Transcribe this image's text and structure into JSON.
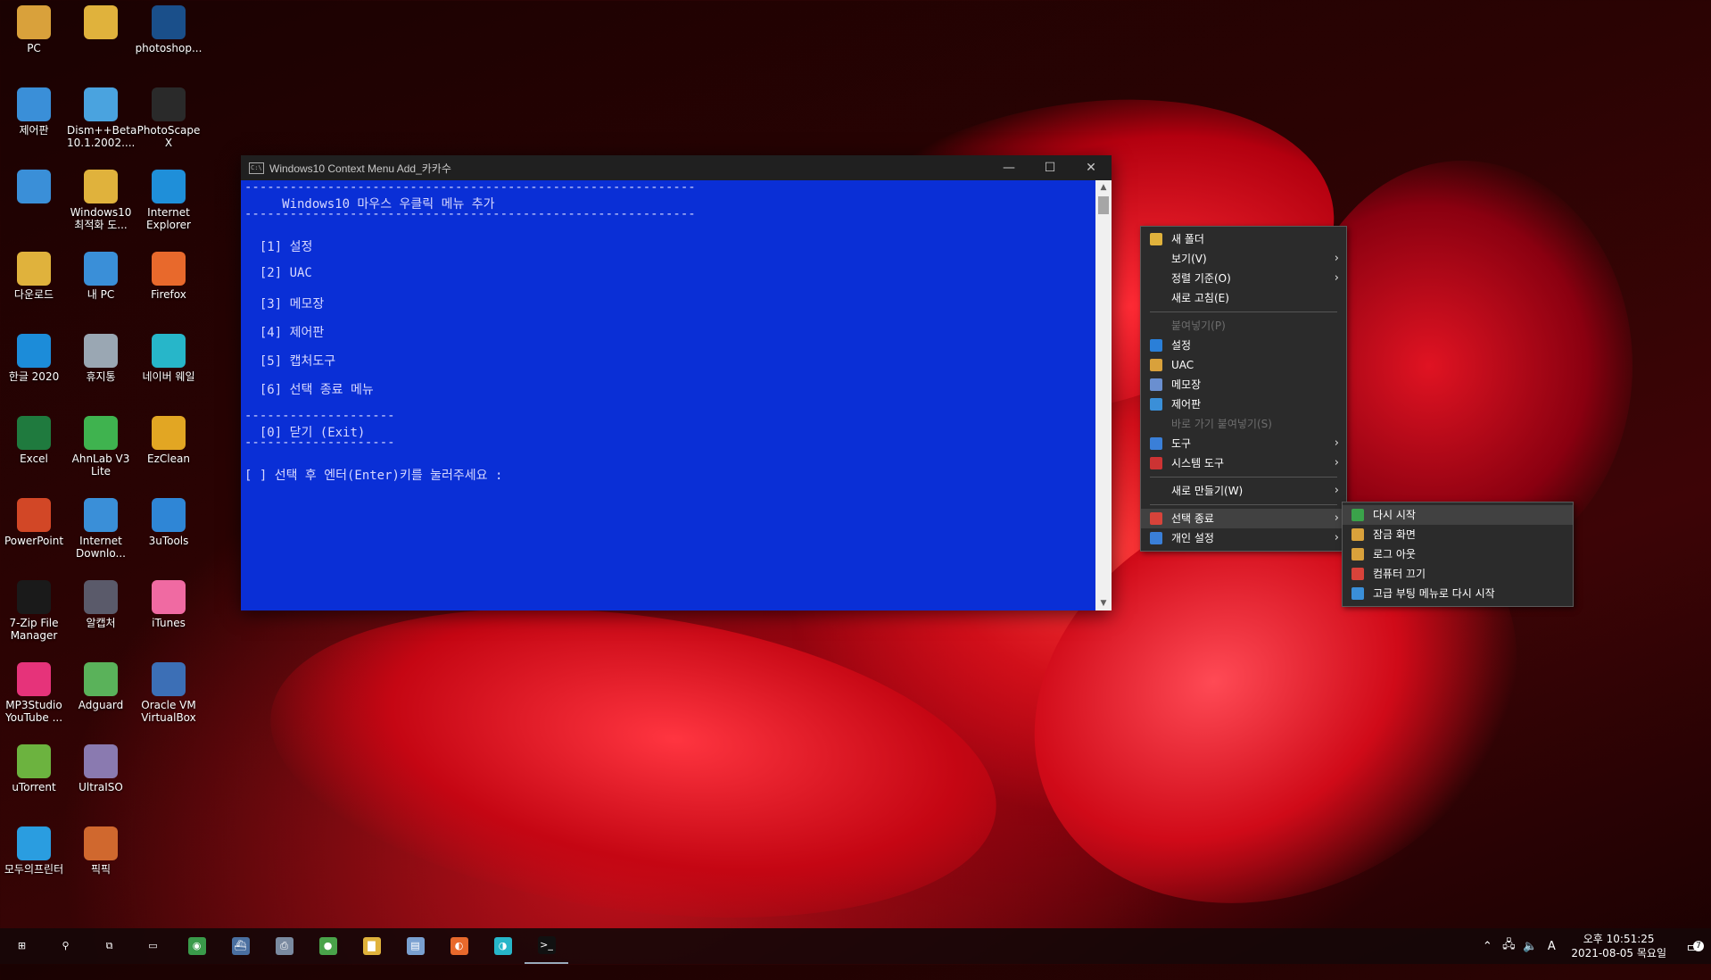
{
  "desktop": {
    "icons": [
      {
        "label": "PC",
        "icon": "user-folder-icon",
        "color": "#d9a13b"
      },
      {
        "label": "제어판",
        "icon": "control-panel-icon",
        "color": "#3a8fd8"
      },
      {
        "label": "",
        "icon": "control-panel-icon",
        "color": "#3a8fd8"
      },
      {
        "label": "다운로드",
        "icon": "download-folder-icon",
        "color": "#e0b23c"
      },
      {
        "label": "한글 2020",
        "icon": "hangul-icon",
        "color": "#1c8cd9"
      },
      {
        "label": "Excel",
        "icon": "excel-icon",
        "color": "#1f7a3e"
      },
      {
        "label": "PowerPoint",
        "icon": "powerpoint-icon",
        "color": "#d24726"
      },
      {
        "label": "7-Zip File Manager",
        "icon": "7zip-icon",
        "color": "#1a1a1a"
      },
      {
        "label": "MP3Studio YouTube ...",
        "icon": "mp3studio-icon",
        "color": "#e6337a"
      },
      {
        "label": "uTorrent",
        "icon": "utorrent-icon",
        "color": "#6cb33f"
      },
      {
        "label": "모두의프린터",
        "icon": "printer-icon",
        "color": "#2a9de0"
      },
      {
        "label": "",
        "icon": "folder-icon",
        "color": "#e0b23c"
      },
      {
        "label": "Dism++Beta 10.1.2002....",
        "icon": "dism-icon",
        "color": "#4aa3df"
      },
      {
        "label": "Windows10 최적화 도...",
        "icon": "folder-icon",
        "color": "#e0b23c"
      },
      {
        "label": "내 PC",
        "icon": "this-pc-icon",
        "color": "#3a8fd8"
      },
      {
        "label": "휴지통",
        "icon": "recycle-bin-icon",
        "color": "#9aa7b3"
      },
      {
        "label": "AhnLab V3 Lite",
        "icon": "ahnlab-icon",
        "color": "#3fb34f"
      },
      {
        "label": "Internet Downlo...",
        "icon": "internet-download-icon",
        "color": "#3a8fd8"
      },
      {
        "label": "알캡처",
        "icon": "alcapture-icon",
        "color": "#5a5a6a"
      },
      {
        "label": "Adguard",
        "icon": "adguard-icon",
        "color": "#5ab25a"
      },
      {
        "label": "UltraISO",
        "icon": "ultraiso-icon",
        "color": "#8a7ab0"
      },
      {
        "label": "픽픽",
        "icon": "picpick-icon",
        "color": "#d0682e"
      },
      {
        "label": "photoshop...",
        "icon": "photoshop-icon",
        "color": "#1a4f8a"
      },
      {
        "label": "PhotoScape X",
        "icon": "photoscape-icon",
        "color": "#2a2a2a"
      },
      {
        "label": "Internet Explorer",
        "icon": "internet-explorer-icon",
        "color": "#1f8fd9"
      },
      {
        "label": "Firefox",
        "icon": "firefox-icon",
        "color": "#e8692c"
      },
      {
        "label": "네이버 웨일",
        "icon": "whale-icon",
        "color": "#27b6c9"
      },
      {
        "label": "EzClean",
        "icon": "ezclean-icon",
        "color": "#e2a623"
      },
      {
        "label": "3uTools",
        "icon": "3utools-icon",
        "color": "#2f86d6"
      },
      {
        "label": "iTunes",
        "icon": "itunes-icon",
        "color": "#f06aa2"
      },
      {
        "label": "Oracle VM VirtualBox",
        "icon": "virtualbox-icon",
        "color": "#3c6fb6"
      }
    ]
  },
  "console": {
    "title": "Windows10 Context Menu Add_카카수",
    "lines": {
      "rule1": "------------------------------------------------------------",
      "heading": "     Windows10 마우스 우클릭 메뉴 추가",
      "rule2": "------------------------------------------------------------",
      "opt1": "  [1] 설정",
      "opt2": "  [2] UAC",
      "opt3": "  [3] 메모장",
      "opt4": "  [4] 제어판",
      "opt5": "  [5] 캡처도구",
      "opt6": "  [6] 선택 종료 메뉴",
      "rule3": "--------------------",
      "opt0": "  [0] 닫기 (Exit)",
      "rule4": "--------------------",
      "prompt": "[ ] 선택 후 엔터(Enter)키를 눌러주세요 :"
    },
    "background": "#0a2fd6"
  },
  "context_menu": {
    "items": [
      {
        "label": "새 폴더",
        "icon": "new-folder-icon",
        "color": "#e0b23c"
      },
      {
        "label": "보기(V)",
        "sub": true
      },
      {
        "label": "정렬 기준(O)",
        "sub": true
      },
      {
        "label": "새로 고침(E)"
      },
      {
        "label": "붙여넣기(P)",
        "disabled": true
      },
      {
        "label": "설정",
        "icon": "settings-gear-icon",
        "color": "#2a7fd8"
      },
      {
        "label": "UAC",
        "icon": "uac-shield-icon",
        "color": "#d9a13b"
      },
      {
        "label": "메모장",
        "icon": "notepad-icon",
        "color": "#6a8fd0"
      },
      {
        "label": "제어판",
        "icon": "control-panel-icon",
        "color": "#3a8fd8"
      },
      {
        "label": "바로 가기 붙여넣기(S)",
        "disabled": true
      },
      {
        "label": "도구",
        "icon": "tools-arrow-icon",
        "color": "#3a7fd8",
        "sub": true
      },
      {
        "label": "시스템 도구",
        "icon": "system-tools-icon",
        "color": "#c33",
        "sub": true
      },
      {
        "label": "새로 만들기(W)",
        "sub": true
      },
      {
        "label": "선택 종료",
        "icon": "shutdown-menu-icon",
        "color": "#d8433a",
        "sub": true,
        "highlight": true
      },
      {
        "label": "개인 설정",
        "icon": "personalize-icon",
        "color": "#3a7fd8",
        "sub": true
      }
    ]
  },
  "submenu": {
    "items": [
      {
        "label": "다시 시작",
        "icon": "restart-icon",
        "color": "#3aa34a",
        "highlight": true
      },
      {
        "label": "잠금 화면",
        "icon": "lock-icon",
        "color": "#d9a13b"
      },
      {
        "label": "로그 아웃",
        "icon": "logout-icon",
        "color": "#d9a13b"
      },
      {
        "label": "컴퓨터 끄기",
        "icon": "power-off-icon",
        "color": "#d8433a"
      },
      {
        "label": "고급 부팅 메뉴로 다시 시작",
        "icon": "advanced-boot-icon",
        "color": "#3a8fd8"
      }
    ]
  },
  "taskbar": {
    "items": [
      {
        "icon": "start-icon",
        "glyph": "⊞",
        "color": "transparent"
      },
      {
        "icon": "search-icon",
        "glyph": "⚲",
        "color": "transparent"
      },
      {
        "icon": "task-view-icon",
        "glyph": "⧉",
        "color": "transparent"
      },
      {
        "icon": "desktop-icon",
        "glyph": "▭",
        "color": "transparent"
      },
      {
        "icon": "globe-app-icon",
        "glyph": "◉",
        "color": "#3a9a4a"
      },
      {
        "icon": "ship-app-icon",
        "glyph": "⛴",
        "color": "#4a6fa0"
      },
      {
        "icon": "printer-app-icon",
        "glyph": "⎙",
        "color": "#7a8aa0"
      },
      {
        "icon": "green-app-icon",
        "glyph": "●",
        "color": "#4aa34a"
      },
      {
        "icon": "file-explorer-icon",
        "glyph": "▇",
        "color": "#e0b23c"
      },
      {
        "icon": "notepad-app-icon",
        "glyph": "▤",
        "color": "#7aa0d0"
      },
      {
        "icon": "firefox-taskbar-icon",
        "glyph": "◐",
        "color": "#e8692c"
      },
      {
        "icon": "whale-taskbar-icon",
        "glyph": "◑",
        "color": "#27b6c9"
      },
      {
        "icon": "console-taskbar-icon",
        "glyph": ">_",
        "color": "#111",
        "active": true
      }
    ],
    "tray": {
      "ime": "A",
      "time": "오후 10:51:25",
      "date": "2021-08-05 목요일",
      "notification_count": "7"
    }
  }
}
